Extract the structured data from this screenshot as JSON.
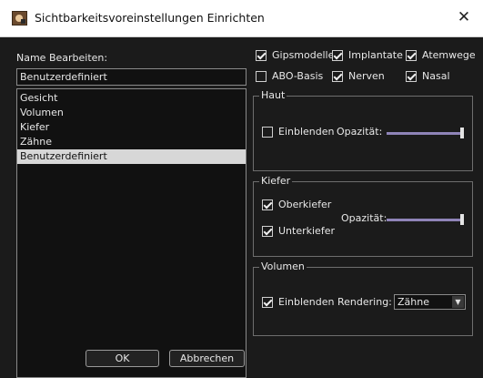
{
  "window": {
    "title": "Sichtbarkeitsvoreinstellungen Einrichten"
  },
  "name_edit": {
    "label": "Name Bearbeiten:",
    "value": "Benutzerdefiniert"
  },
  "presets": [
    "Gesicht",
    "Volumen",
    "Kiefer",
    "Zähne",
    "Benutzerdefiniert"
  ],
  "selected_preset": "Benutzerdefiniert",
  "top_checks": {
    "gipsmodelle": {
      "label": "Gipsmodelle",
      "checked": true
    },
    "implantate": {
      "label": "Implantate",
      "checked": true
    },
    "atemwege": {
      "label": "Atemwege",
      "checked": true
    },
    "abo_basis": {
      "label": "ABO-Basis",
      "checked": false
    },
    "nerven": {
      "label": "Nerven",
      "checked": true
    },
    "nasal": {
      "label": "Nasal",
      "checked": true
    }
  },
  "haut": {
    "title": "Haut",
    "einblenden": {
      "label": "Einblenden",
      "checked": false
    },
    "opacity_label": "Opazität:",
    "opacity": 1.0
  },
  "kiefer": {
    "title": "Kiefer",
    "oberkiefer": {
      "label": "Oberkiefer",
      "checked": true
    },
    "unterkiefer": {
      "label": "Unterkiefer",
      "checked": true
    },
    "opacity_label": "Opazität:",
    "opacity": 1.0
  },
  "volumen": {
    "title": "Volumen",
    "einblenden": {
      "label": "Einblenden",
      "checked": true
    },
    "rendering_label": "Rendering:",
    "rendering_value": "Zähne"
  },
  "buttons": {
    "ok": "OK",
    "cancel": "Abbrechen"
  },
  "icons": {
    "app": "app-icon",
    "close": "close-icon",
    "dropdown": "chevron-down-icon"
  }
}
